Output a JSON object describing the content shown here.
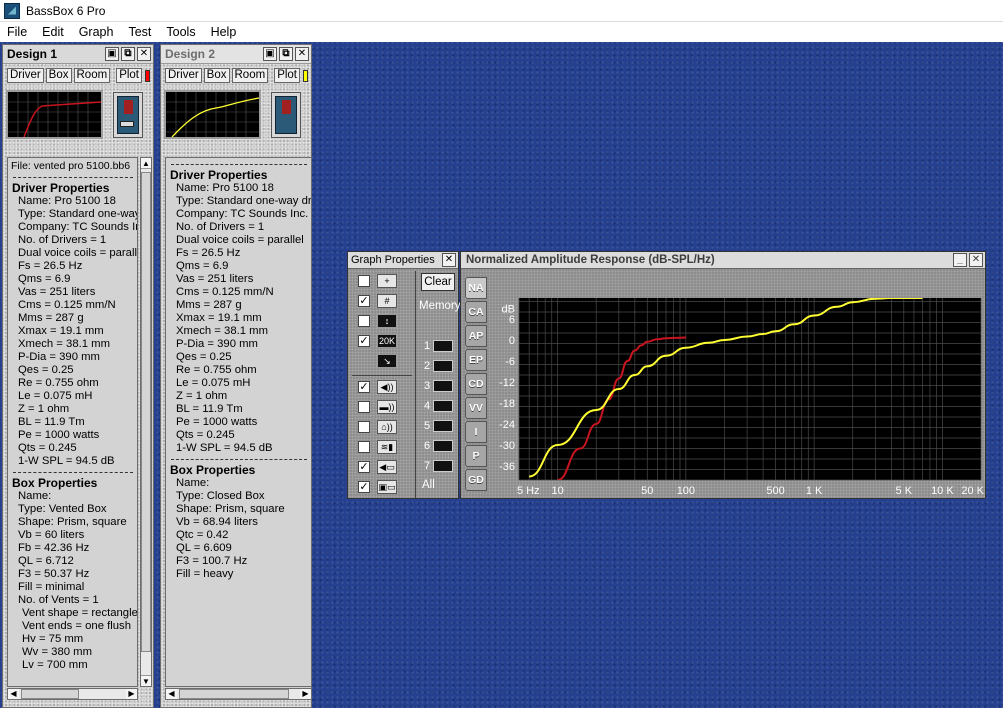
{
  "app": {
    "title": "BassBox 6 Pro"
  },
  "menu": [
    "File",
    "Edit",
    "Graph",
    "Test",
    "Tools",
    "Help"
  ],
  "design1": {
    "title": "Design 1",
    "tabs": [
      "Driver",
      "Box",
      "Room",
      "Plot"
    ],
    "plot_color": "#ff0000",
    "file": "File: vented pro 5100.bb6",
    "driver_heading": "Driver Properties",
    "driver_props": [
      "Name: Pro 5100 18",
      "Type: Standard one-way d",
      "Company: TC Sounds Inc",
      "No. of Drivers = 1",
      "Dual voice coils = parallel",
      "Fs = 26.5 Hz",
      "Qms = 6.9",
      "Vas = 251 liters",
      "Cms = 0.125 mm/N",
      "Mms = 287 g",
      "Xmax = 19.1 mm",
      "Xmech = 38.1 mm",
      "P-Dia = 390 mm",
      "Qes = 0.25",
      "Re = 0.755 ohm",
      "Le = 0.075 mH",
      "Z = 1 ohm",
      "BL = 11.9 Tm",
      "Pe = 1000 watts",
      "Qts = 0.245",
      "1-W SPL = 94.5 dB"
    ],
    "box_heading": "Box Properties",
    "box_props": [
      "Name:",
      "Type: Vented Box",
      "Shape: Prism, square",
      "Vb = 60 liters",
      "Fb = 42.36 Hz",
      "QL = 6.712",
      "F3 = 50.37 Hz",
      "Fill = minimal",
      "No. of Vents = 1"
    ],
    "vent_props": [
      "Vent shape = rectangle",
      "Vent ends = one flush",
      "Hv = 75 mm",
      "Wv = 380 mm",
      "Lv = 700 mm"
    ]
  },
  "design2": {
    "title": "Design 2",
    "tabs": [
      "Driver",
      "Box",
      "Room",
      "Plot"
    ],
    "plot_color": "#ffff00",
    "driver_heading": "Driver Properties",
    "driver_props": [
      "Name: Pro 5100 18",
      "Type: Standard one-way driv",
      "Company: TC Sounds Inc.",
      "No. of Drivers = 1",
      "Dual voice coils = parallel",
      "Fs = 26.5 Hz",
      "Qms = 6.9",
      "Vas = 251 liters",
      "Cms = 0.125 mm/N",
      "Mms = 287 g",
      "Xmax = 19.1 mm",
      "Xmech = 38.1 mm",
      "P-Dia = 390 mm",
      "Qes = 0.25",
      "Re = 0.755 ohm",
      "Le = 0.075 mH",
      "Z = 1 ohm",
      "BL = 11.9 Tm",
      "Pe = 1000 watts",
      "Qts = 0.245",
      "1-W SPL = 94.5 dB"
    ],
    "box_heading": "Box Properties",
    "box_props": [
      "Name:",
      "Type: Closed Box",
      "Shape: Prism, square",
      "Vb = 68.94 liters",
      "Qtc = 0.42",
      "QL = 6.609",
      "F3 = 100.7 Hz",
      "Fill = heavy"
    ]
  },
  "graph_properties": {
    "title": "Graph Properties",
    "clear_label": "Clear",
    "memory_label": "Memory",
    "memory_slots": [
      "1",
      "2",
      "3",
      "4",
      "5",
      "6",
      "7"
    ],
    "all_label": "All",
    "options": [
      {
        "checked": false,
        "icon": "crosshair-icon",
        "glyph": "+"
      },
      {
        "checked": true,
        "icon": "grid-icon",
        "glyph": "#"
      },
      {
        "checked": false,
        "icon": "scale-arrows-icon",
        "glyph": "↕"
      },
      {
        "checked": true,
        "icon": "range-20k-icon",
        "glyph": "20K"
      },
      {
        "checked": null,
        "icon": "export-icon",
        "glyph": "↘"
      },
      {
        "checked": true,
        "icon": "speaker-response-icon",
        "glyph": "◀))"
      },
      {
        "checked": false,
        "icon": "box-response-icon",
        "glyph": "▬))"
      },
      {
        "checked": false,
        "icon": "room-response-icon",
        "glyph": "⌂))"
      },
      {
        "checked": false,
        "icon": "filter-icon",
        "glyph": "≋▮"
      },
      {
        "checked": true,
        "icon": "speaker-output-icon",
        "glyph": "◀▭"
      },
      {
        "checked": true,
        "icon": "sub-output-icon",
        "glyph": "▣▭"
      }
    ]
  },
  "graph": {
    "title": "Normalized Amplitude Response (dB-SPL/Hz)",
    "side_tabs": [
      "NA",
      "CA",
      "AP",
      "EP",
      "CD",
      "VV",
      "I",
      "P",
      "GD"
    ],
    "active_tab": "NA",
    "colors": {
      "background": "#000000",
      "grid": "#4a4a4a",
      "design1": "#c8141e",
      "design2": "#ffff32"
    }
  },
  "chart_data": {
    "type": "line",
    "title": "Normalized Amplitude Response (dB-SPL/Hz)",
    "xlabel": "",
    "ylabel": "dB",
    "x_scale": "log",
    "xlim": [
      5,
      20000
    ],
    "ylim": [
      -40,
      12
    ],
    "x_tick_labels": [
      "5 Hz",
      "10",
      "50",
      "100",
      "500",
      "1 K",
      "5 K",
      "10 K",
      "20 K"
    ],
    "x_tick_values": [
      5,
      10,
      50,
      100,
      500,
      1000,
      5000,
      10000,
      20000
    ],
    "y_tick_labels": [
      "dB",
      "6",
      "0",
      "-6",
      "-12",
      "-18",
      "-24",
      "-30",
      "-36"
    ],
    "y_tick_values": [
      null,
      6,
      0,
      -6,
      -12,
      -18,
      -24,
      -30,
      -36
    ],
    "grid": true,
    "series": [
      {
        "name": "Design 1",
        "color": "#c8141e",
        "x": [
          10,
          15,
          20,
          25,
          30,
          35,
          40,
          45,
          50,
          60,
          70,
          80,
          100
        ],
        "y": [
          -40,
          -31,
          -24,
          -17,
          -11,
          -6,
          -3,
          -1.5,
          -0.5,
          0.2,
          0.5,
          0.6,
          0.7
        ]
      },
      {
        "name": "Design 2",
        "color": "#ffff32",
        "x": [
          6,
          10,
          20,
          30,
          40,
          50,
          70,
          100,
          150,
          200,
          300,
          400,
          500,
          700,
          1000,
          1500,
          2000,
          3000,
          4000,
          5000,
          7000
        ],
        "y": [
          -39,
          -30,
          -20,
          -14,
          -10,
          -7.5,
          -4.5,
          -2.2,
          -0.8,
          0,
          1,
          1.7,
          2.5,
          4.5,
          7,
          9.5,
          10.8,
          11.8,
          12,
          12,
          12
        ]
      }
    ]
  }
}
